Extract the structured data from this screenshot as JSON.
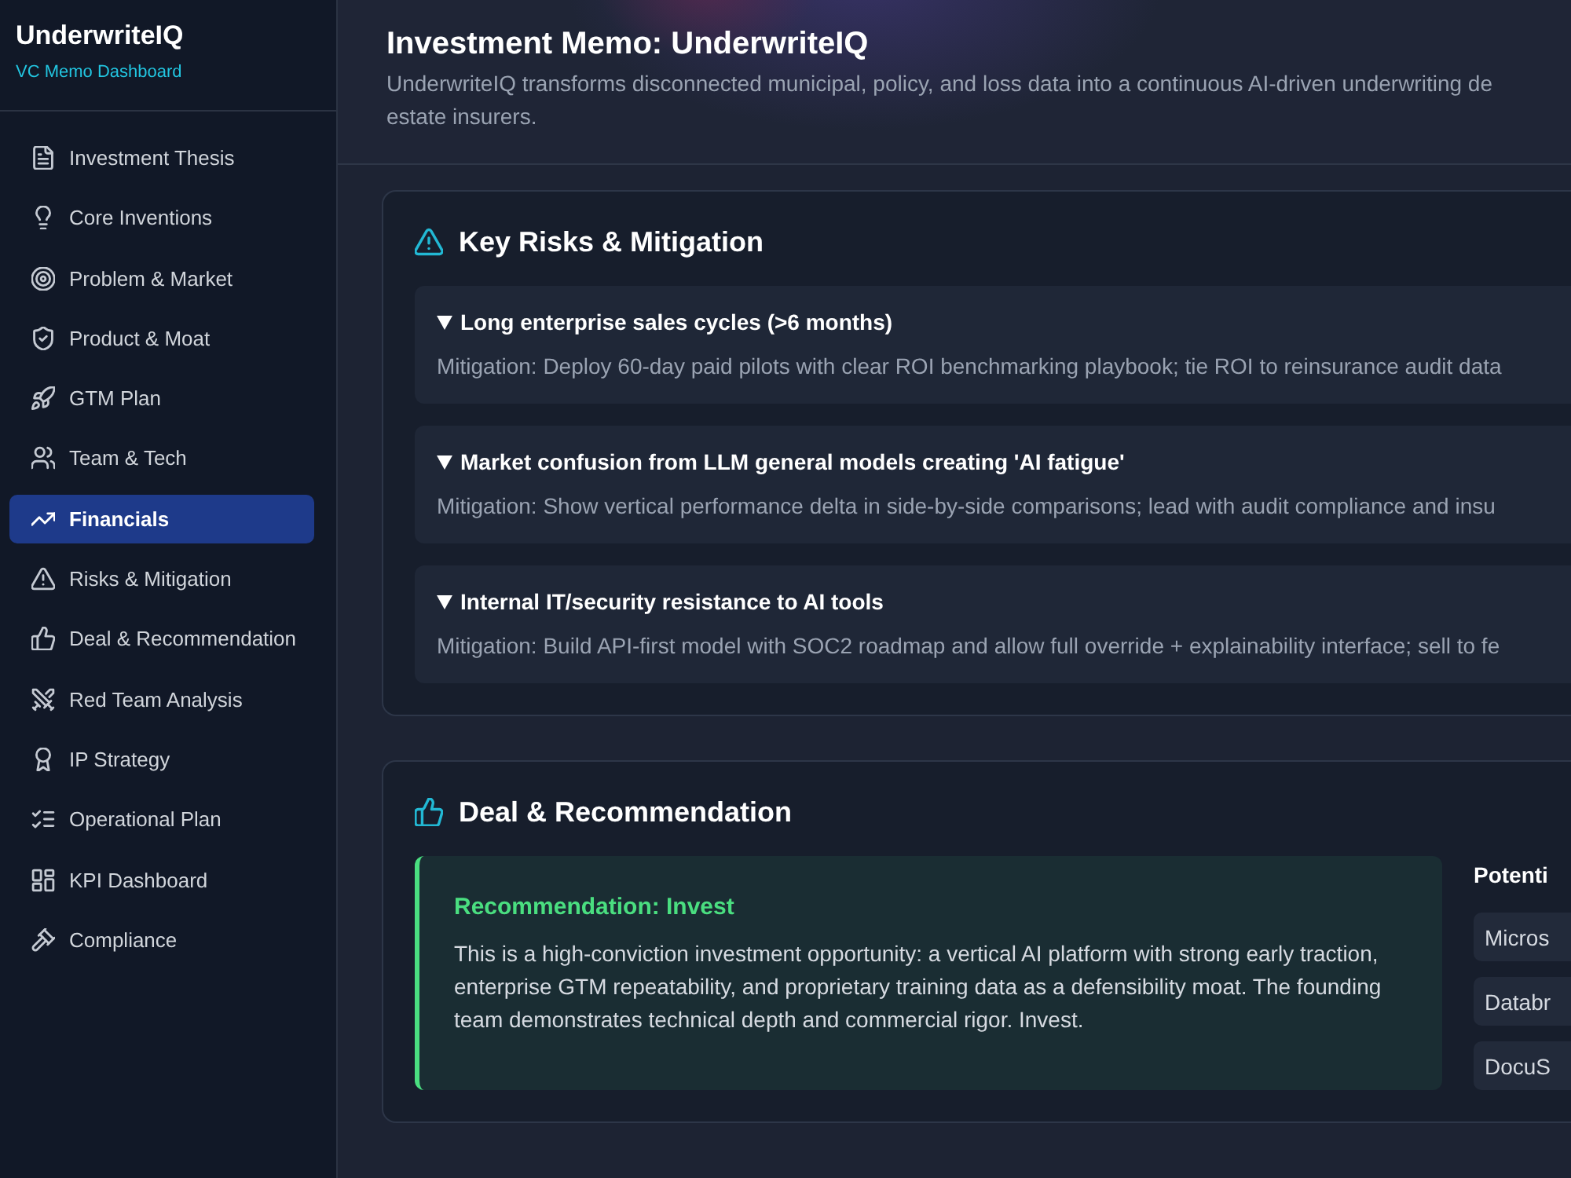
{
  "sidebar": {
    "brand": "UnderwriteIQ",
    "tagline": "VC Memo Dashboard",
    "items": [
      {
        "label": "Investment Thesis",
        "selected": false
      },
      {
        "label": "Core Inventions",
        "selected": false
      },
      {
        "label": "Problem & Market",
        "selected": false
      },
      {
        "label": "Product & Moat",
        "selected": false
      },
      {
        "label": "GTM Plan",
        "selected": false
      },
      {
        "label": "Team & Tech",
        "selected": false
      },
      {
        "label": "Financials",
        "selected": true
      },
      {
        "label": "Risks & Mitigation",
        "selected": false
      },
      {
        "label": "Deal & Recommendation",
        "selected": false
      },
      {
        "label": "Red Team Analysis",
        "selected": false
      },
      {
        "label": "IP Strategy",
        "selected": false
      },
      {
        "label": "Operational Plan",
        "selected": false
      },
      {
        "label": "KPI Dashboard",
        "selected": false
      },
      {
        "label": "Compliance",
        "selected": false
      }
    ]
  },
  "header": {
    "title": "Investment Memo: UnderwriteIQ",
    "summary_lines": [
      "UnderwriteIQ transforms disconnected municipal, policy, and loss data into a continuous AI-driven underwriting de",
      "estate insurers."
    ]
  },
  "sections": [
    {
      "kind": "risks",
      "title": "Key Risks & Mitigation",
      "risks": [
        {
          "title": "Long enterprise sales cycles (>6 months)",
          "mitigation": "Mitigation: Deploy 60-day paid pilots with clear ROI benchmarking playbook; tie ROI to reinsurance audit data",
          "expanded": true
        },
        {
          "title": "Market confusion from LLM general models creating 'AI fatigue'",
          "mitigation": "Mitigation: Show vertical performance delta in side-by-side comparisons; lead with audit compliance and insu",
          "expanded": true
        },
        {
          "title": "Internal IT/security resistance to AI tools",
          "mitigation": "Mitigation: Build API-first model with SOC2 roadmap and allow full override + explainability interface; sell to fe",
          "expanded": true
        }
      ]
    },
    {
      "kind": "deal",
      "title": "Deal & Recommendation",
      "recommendation": {
        "title": "Recommendation: Invest",
        "text": "This is a high-conviction investment opportunity: a vertical AI platform with strong early traction, enterprise GTM repeatability, and proprietary training data as a defensibility moat. The founding team demonstrates technical depth and commercial rigor. Invest."
      },
      "side_column": {
        "heading": "Potenti",
        "items": [
          "Micros",
          "Databr",
          "DocuS"
        ]
      }
    }
  ]
}
